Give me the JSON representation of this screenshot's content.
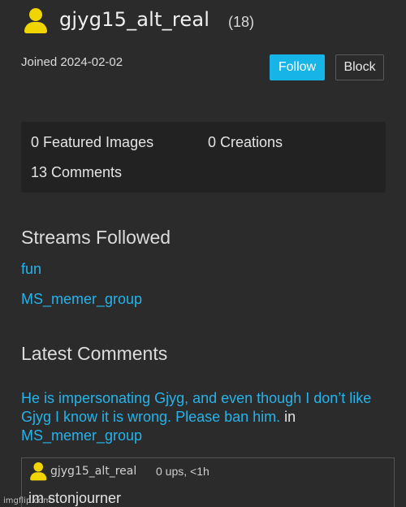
{
  "profile": {
    "username": "gjyg15_alt_real",
    "points": "(18)",
    "joined": "Joined 2024-02-02",
    "follow_label": "Follow",
    "block_label": "Block"
  },
  "stats": {
    "featured": "0 Featured Images",
    "creations": "0 Creations",
    "comments": "13 Comments"
  },
  "streams": {
    "title": "Streams Followed",
    "items": [
      "fun",
      "MS_memer_group"
    ]
  },
  "latest_comments": {
    "title": "Latest Comments",
    "comment_text": "He is impersonating Gjyg, and even though I don’t like Gjyg I know it is wrong. Please ban him.",
    "in_label": "in",
    "stream": "MS_memer_group"
  },
  "reply": {
    "username": "gjyg15_alt_real",
    "meta": "0 ups, <1h",
    "body": "im stonjourner"
  },
  "watermark": "imgflip.com",
  "colors": {
    "background": "#2b2b2b",
    "panel": "#222222",
    "accent": "#16b4e7",
    "link": "#26b3ea",
    "avatar": "#f0d500"
  },
  "icons": {
    "avatar": "user-avatar-icon"
  }
}
